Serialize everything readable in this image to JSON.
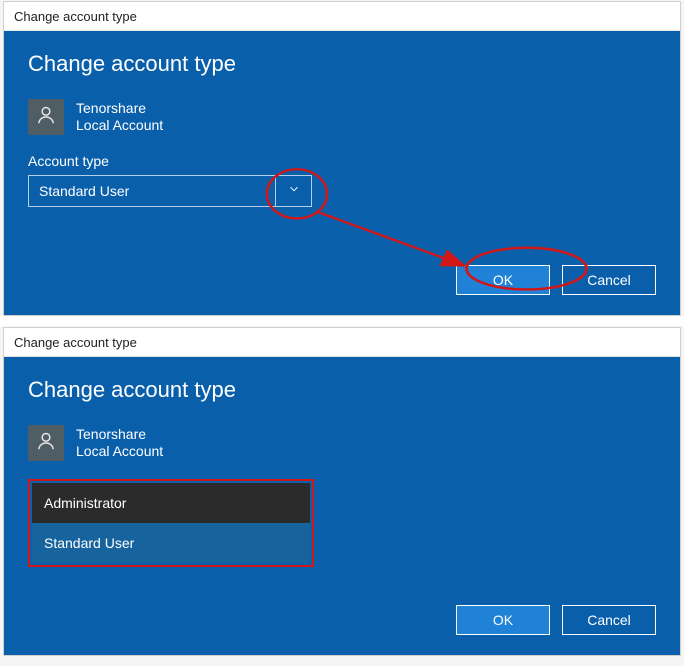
{
  "window1": {
    "title": "Change account type",
    "heading": "Change account type",
    "account_name": "Tenorshare",
    "account_sub": "Local Account",
    "field_label": "Account type",
    "selected_value": "Standard User",
    "ok_label": "OK",
    "cancel_label": "Cancel"
  },
  "window2": {
    "title": "Change account type",
    "heading": "Change account type",
    "account_name": "Tenorshare",
    "account_sub": "Local Account",
    "options": {
      "0": "Administrator",
      "1": "Standard User"
    },
    "ok_label": "OK",
    "cancel_label": "Cancel"
  },
  "annotation_color": "#d21515"
}
